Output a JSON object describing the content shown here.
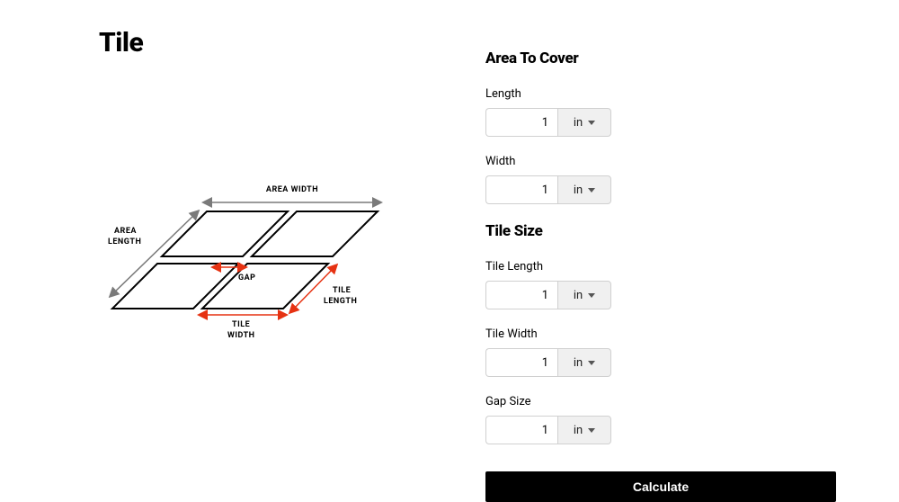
{
  "page_title": "Tile",
  "diagram": {
    "area_width_label": "AREA WIDTH",
    "area_length_label": "AREA LENGTH",
    "tile_length_label": "TILE LENGTH",
    "tile_width_label": "TILE WIDTH",
    "gap_label": "GAP"
  },
  "sections": {
    "area": {
      "title": "Area To Cover",
      "length": {
        "label": "Length",
        "value": "1",
        "unit": "in"
      },
      "width": {
        "label": "Width",
        "value": "1",
        "unit": "in"
      }
    },
    "tile": {
      "title": "Tile Size",
      "length": {
        "label": "Tile Length",
        "value": "1",
        "unit": "in"
      },
      "width": {
        "label": "Tile Width",
        "value": "1",
        "unit": "in"
      },
      "gap": {
        "label": "Gap Size",
        "value": "1",
        "unit": "in"
      }
    }
  },
  "calculate_label": "Calculate"
}
